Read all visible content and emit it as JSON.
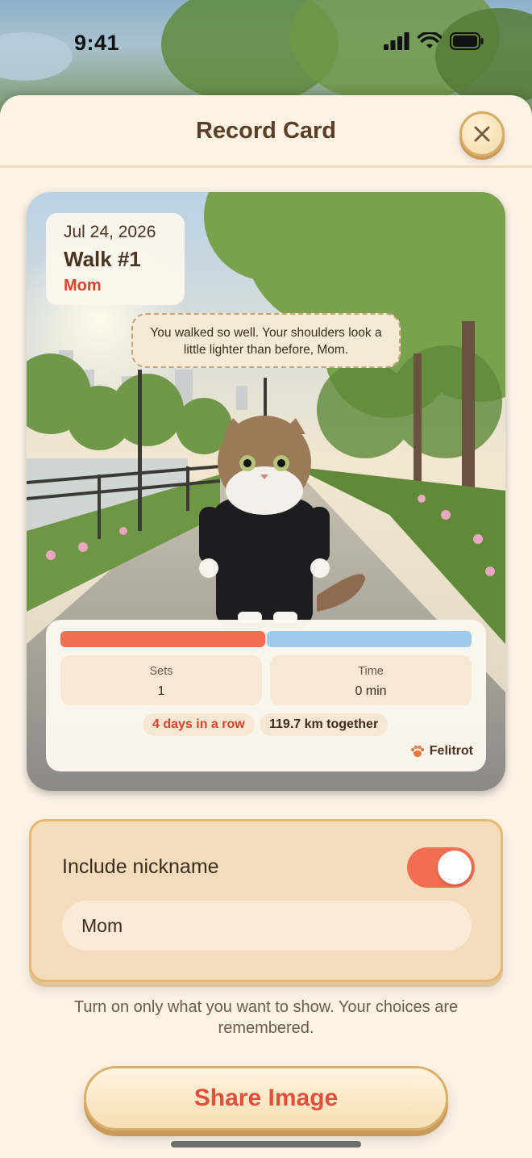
{
  "status_bar": {
    "time": "9:41"
  },
  "sheet": {
    "title": "Record Card"
  },
  "card": {
    "date": "Jul 24, 2026",
    "walk": "Walk #1",
    "nickname": "Mom",
    "speech": "You walked so well. Your shoulders look a little lighter than before, Mom.",
    "progress": {
      "left_fraction": 0.5,
      "right_fraction": 0.5,
      "left_color": "#f26e52",
      "right_color": "#9fcaee"
    },
    "stats": [
      {
        "label": "Sets",
        "value": "1"
      },
      {
        "label": "Time",
        "value": "0 min"
      }
    ],
    "streak": "4 days in a row",
    "distance": "119.7 km together",
    "brand": "Felitrot"
  },
  "settings": {
    "include_nickname_label": "Include nickname",
    "include_nickname_on": true,
    "nickname_value": "Mom"
  },
  "hint": "Turn on only what you want to show. Your choices are remembered.",
  "share_button": "Share Image",
  "colors": {
    "accent": "#f26e52",
    "title_brown": "#5a3e25",
    "sheet_bg": "#fcf3e5",
    "brand_red": "#e2503a"
  }
}
